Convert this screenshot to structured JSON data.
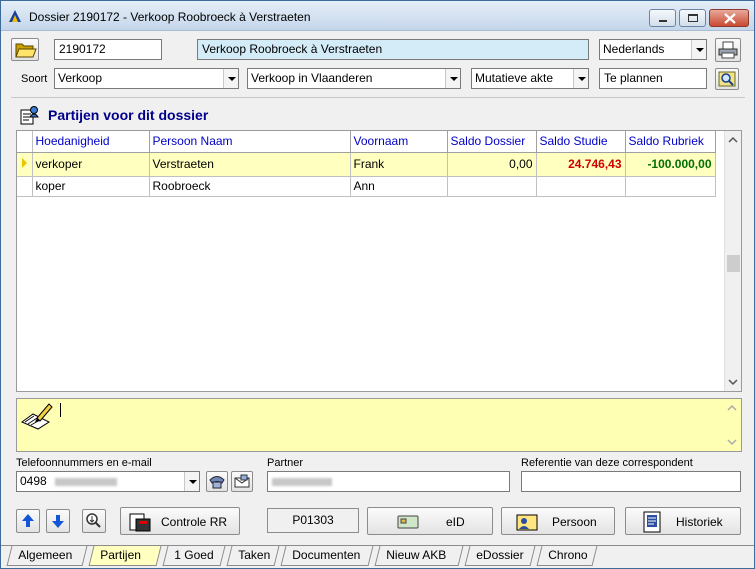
{
  "window": {
    "title": "Dossier 2190172 - Verkoop Roobroeck à Verstraeten"
  },
  "dossier": {
    "number": "2190172",
    "description": "Verkoop Roobroeck à Verstraeten",
    "language": "Nederlands",
    "soort_label": "Soort",
    "soort": "Verkoop",
    "region": "Verkoop in Vlaanderen",
    "akte": "Mutatieve akte",
    "status": "Te plannen"
  },
  "partijen": {
    "title": "Partijen voor dit dossier",
    "columns": [
      "Hoedanigheid",
      "Persoon Naam",
      "Voornaam",
      "Saldo Dossier",
      "Saldo Studie",
      "Saldo Rubriek"
    ],
    "rows": [
      {
        "hoedanigheid": "verkoper",
        "naam": "Verstraeten",
        "voornaam": "Frank",
        "saldo_dossier": "0,00",
        "saldo_studie": "24.746,43",
        "saldo_rubriek": "-100.000,00"
      },
      {
        "hoedanigheid": "koper",
        "naam": "Roobroeck",
        "voornaam": "Ann",
        "saldo_dossier": "",
        "saldo_studie": "",
        "saldo_rubriek": ""
      }
    ]
  },
  "contact": {
    "phone_label": "Telefoonnummers en e-mail",
    "phone_value": "0498",
    "partner_label": "Partner",
    "reference_label": "Referentie van deze correspondent"
  },
  "toolbar": {
    "controle_label": "Controle RR",
    "code": "P01303",
    "eid_label": "eID",
    "persoon_label": "Persoon",
    "historiek_label": "Historiek"
  },
  "tabs": [
    "Algemeen",
    "Partijen",
    "1 Goed",
    "Taken",
    "Documenten",
    "Nieuw AKB",
    "eDossier",
    "Chrono"
  ],
  "active_tab": "Partijen",
  "colors": {
    "selected_row": "#ffffc0",
    "note_bg": "#ffffb4",
    "header_text": "#0000c8",
    "negative": "#007000",
    "positive": "#d00000"
  }
}
